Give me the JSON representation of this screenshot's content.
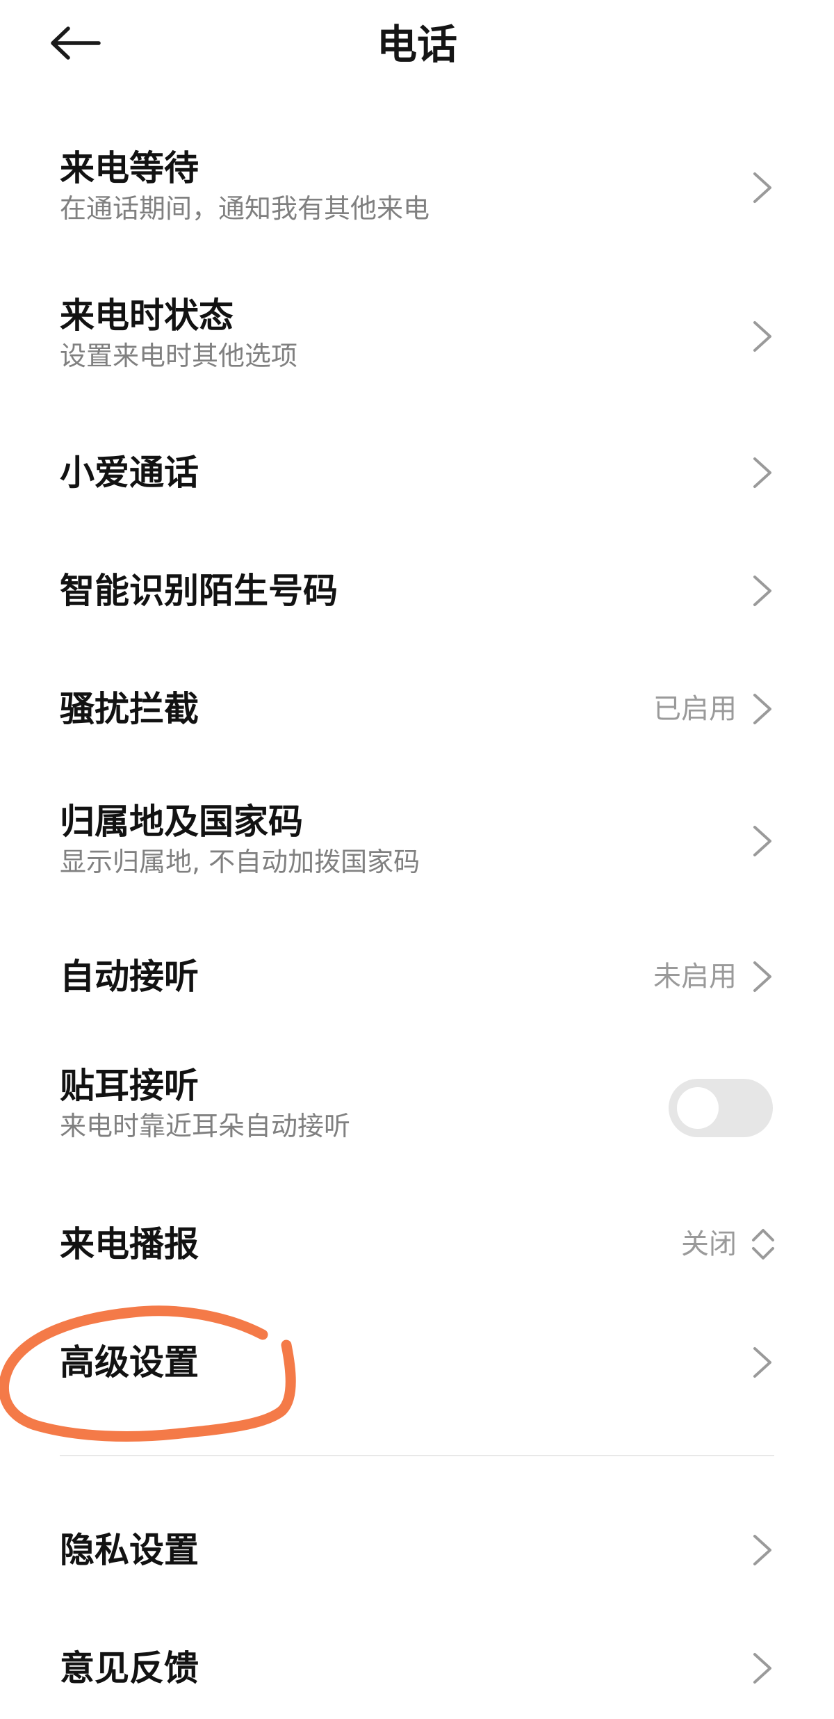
{
  "header": {
    "title": "电话",
    "back_icon": "arrow-left-icon"
  },
  "settings": {
    "call_waiting": {
      "title": "来电等待",
      "subtitle": "在通话期间，通知我有其他来电"
    },
    "incoming_call_status": {
      "title": "来电时状态",
      "subtitle": "设置来电时其他选项"
    },
    "xiaoai_call": {
      "title": "小爱通话"
    },
    "unknown_number_id": {
      "title": "智能识别陌生号码"
    },
    "harassment_block": {
      "title": "骚扰拦截",
      "value": "已启用"
    },
    "location_country_code": {
      "title": "归属地及国家码",
      "subtitle": "显示归属地, 不自动加拨国家码"
    },
    "auto_answer": {
      "title": "自动接听",
      "value": "未启用"
    },
    "ear_answer": {
      "title": "贴耳接听",
      "subtitle": "来电时靠近耳朵自动接听",
      "enabled": false
    },
    "caller_announce": {
      "title": "来电播报",
      "value": "关闭"
    },
    "advanced_settings": {
      "title": "高级设置"
    },
    "privacy_settings": {
      "title": "隐私设置"
    },
    "feedback": {
      "title": "意见反馈"
    }
  },
  "colors": {
    "annotation_stroke": "#f47a48",
    "toggle_off": "#e6e6e6",
    "secondary_text": "#808080"
  }
}
